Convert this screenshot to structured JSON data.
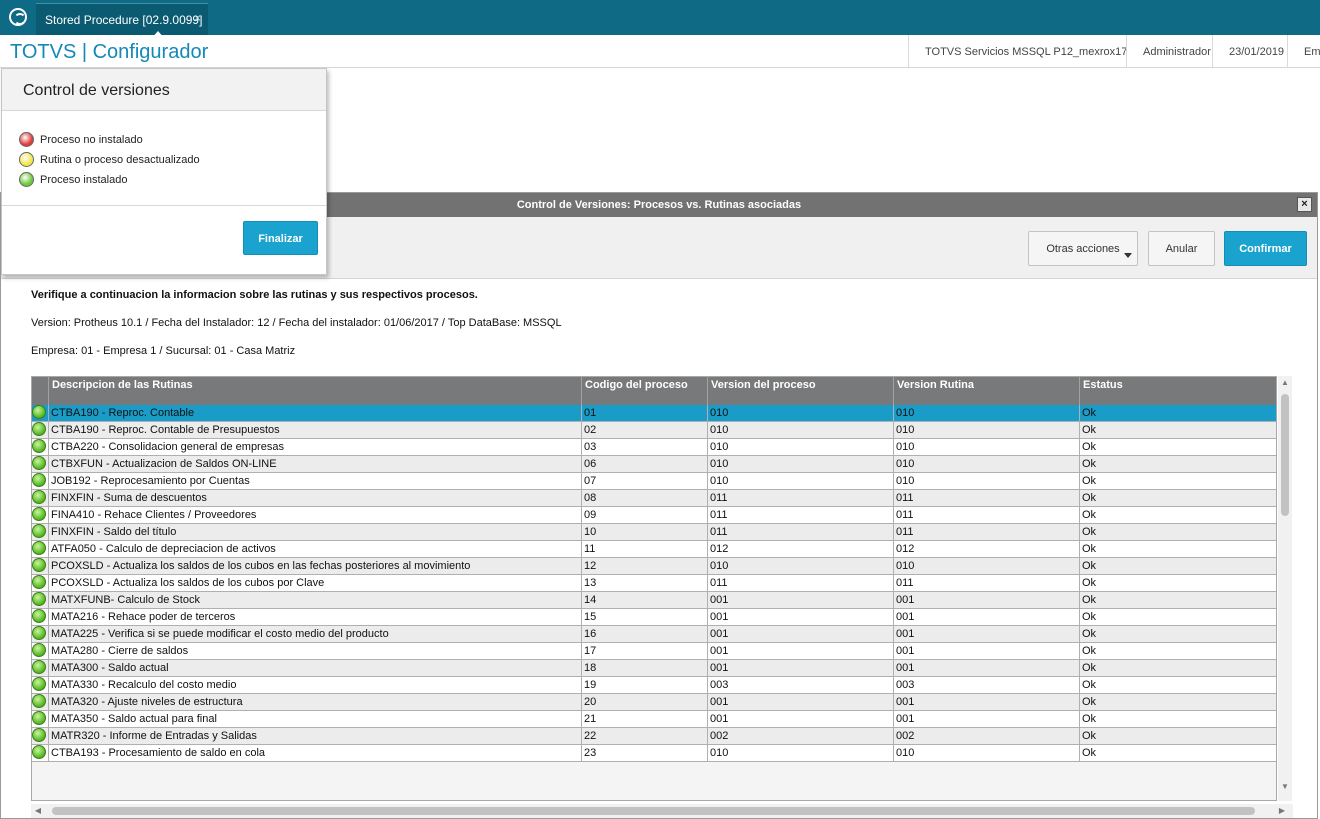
{
  "tab": {
    "title": "Stored Procedure [02.9.0099]",
    "close": "×"
  },
  "header": {
    "brand": "TOTVS | Configurador",
    "server": "TOTVS Servicios MSSQL P12_mexrox17",
    "user": "Administrador",
    "date": "23/01/2019",
    "company": "Emp"
  },
  "popup": {
    "title": "Control de versiones",
    "legend": [
      {
        "label": "Proceso no instalado",
        "color": "#e23b3b"
      },
      {
        "label": "Rutina o proceso desactualizado",
        "color": "#f2e64a"
      },
      {
        "label": "Proceso instalado",
        "color": "#6cc93a"
      }
    ],
    "finish_label": "Finalizar"
  },
  "dialog": {
    "title": "Control de Versiones: Procesos vs. Rutinas asociadas",
    "close": "×",
    "other_actions_label": "Otras acciones",
    "cancel_label": "Anular",
    "confirm_label": "Confirmar",
    "intro": "Verifique a continuacion la informacion sobre las rutinas y sus respectivos procesos.",
    "version_line": "Version: Protheus 10.1 / Fecha del Instalador: 12 / Fecha del instalador: 01/06/2017 / Top DataBase: MSSQL",
    "company_line": "Empresa: 01 - Empresa 1 / Sucursal: 01 - Casa Matriz"
  },
  "table": {
    "columns": [
      "Descripcion de las Rutinas",
      "Codigo del proceso",
      "Version del proceso",
      "Version Rutina",
      "Estatus"
    ],
    "selected_index": 0,
    "rows": [
      [
        "CTBA190 - Reproc. Contable",
        "01",
        "010",
        "010",
        "Ok"
      ],
      [
        "CTBA190 - Reproc. Contable de Presupuestos",
        "02",
        "010",
        "010",
        "Ok"
      ],
      [
        "CTBA220 - Consolidacion general de empresas",
        "03",
        "010",
        "010",
        "Ok"
      ],
      [
        "CTBXFUN - Actualizacion de Saldos ON-LINE",
        "06",
        "010",
        "010",
        "Ok"
      ],
      [
        "JOB192 - Reprocesamiento por Cuentas",
        "07",
        "010",
        "010",
        "Ok"
      ],
      [
        "FINXFIN - Suma de descuentos",
        "08",
        "011",
        "011",
        "Ok"
      ],
      [
        "FINA410 - Rehace Clientes / Proveedores",
        "09",
        "011",
        "011",
        "Ok"
      ],
      [
        "FINXFIN - Saldo del título",
        "10",
        "011",
        "011",
        "Ok"
      ],
      [
        "ATFA050 - Calculo de depreciacion de activos",
        "11",
        "012",
        "012",
        "Ok"
      ],
      [
        "PCOXSLD - Actualiza los saldos de los cubos en las fechas posteriores al movimiento",
        "12",
        "010",
        "010",
        "Ok"
      ],
      [
        "PCOXSLD - Actualiza los saldos de los cubos por Clave",
        "13",
        "011",
        "011",
        "Ok"
      ],
      [
        "MATXFUNB- Calculo de Stock",
        "14",
        "001",
        "001",
        "Ok"
      ],
      [
        "MATA216 - Rehace poder de terceros",
        "15",
        "001",
        "001",
        "Ok"
      ],
      [
        "MATA225 - Verifica si se puede modificar el costo medio del producto",
        "16",
        "001",
        "001",
        "Ok"
      ],
      [
        "MATA280 - Cierre de saldos",
        "17",
        "001",
        "001",
        "Ok"
      ],
      [
        "MATA300 - Saldo actual",
        "18",
        "001",
        "001",
        "Ok"
      ],
      [
        "MATA330 - Recalculo del costo medio",
        "19",
        "003",
        "003",
        "Ok"
      ],
      [
        "MATA320 - Ajuste niveles de estructura",
        "20",
        "001",
        "001",
        "Ok"
      ],
      [
        "MATA350 - Saldo actual para final",
        "21",
        "001",
        "001",
        "Ok"
      ],
      [
        "MATR320 - Informe de Entradas y Salidas",
        "22",
        "002",
        "002",
        "Ok"
      ],
      [
        "CTBA193 - Procesamiento de saldo en cola",
        "23",
        "010",
        "010",
        "Ok"
      ]
    ]
  },
  "scroll": {
    "up": "▲",
    "down": "▼",
    "left": "◀",
    "right": "▶"
  }
}
